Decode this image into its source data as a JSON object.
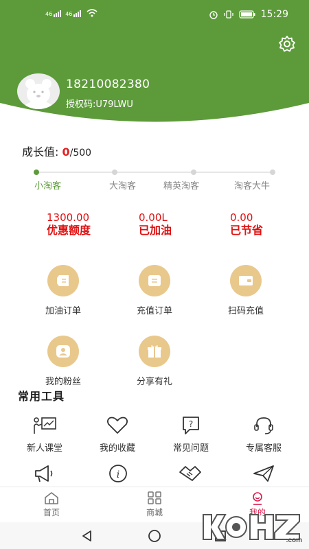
{
  "status_bar": {
    "signal_1": "46",
    "signal_2": "46",
    "time": "15:29"
  },
  "profile": {
    "phone": "18210082380",
    "auth_code": "授权码:U79LWU"
  },
  "growth": {
    "label": "成长值:",
    "current": "0",
    "max": "/500"
  },
  "levels": [
    "小淘客",
    "大淘客",
    "精英淘客",
    "淘客大牛"
  ],
  "stats": [
    {
      "value": "1300.00",
      "label": "优惠额度"
    },
    {
      "value": "0.00L",
      "label": "已加油"
    },
    {
      "value": "0.00",
      "label": "已节省"
    }
  ],
  "menu": [
    {
      "label": "加油订单",
      "icon": "fuel-order-icon"
    },
    {
      "label": "充值订单",
      "icon": "recharge-order-icon"
    },
    {
      "label": "扫码充值",
      "icon": "wallet-icon"
    },
    {
      "label": "我的粉丝",
      "icon": "fans-icon"
    },
    {
      "label": "分享有礼",
      "icon": "gift-icon"
    }
  ],
  "tools_title": "常用工具",
  "tools": [
    {
      "label": "新人课堂",
      "icon": "classroom-icon"
    },
    {
      "label": "我的收藏",
      "icon": "heart-icon"
    },
    {
      "label": "常见问题",
      "icon": "question-icon"
    },
    {
      "label": "专属客服",
      "icon": "headset-icon"
    }
  ],
  "tools_row2_icons": [
    "megaphone-icon",
    "info-icon",
    "handshake-icon",
    "paper-plane-icon"
  ],
  "tabs": [
    {
      "label": "首页",
      "icon": "home-icon"
    },
    {
      "label": "商城",
      "icon": "grid-icon"
    },
    {
      "label": "我的",
      "icon": "profile-icon",
      "active": true
    }
  ],
  "watermark": "K•H•O•Z.com",
  "colors": {
    "brand_green": "#5d9b3a",
    "accent_red": "#e01010",
    "gold": "#e9c88c",
    "active_tab": "#d81b4a"
  }
}
